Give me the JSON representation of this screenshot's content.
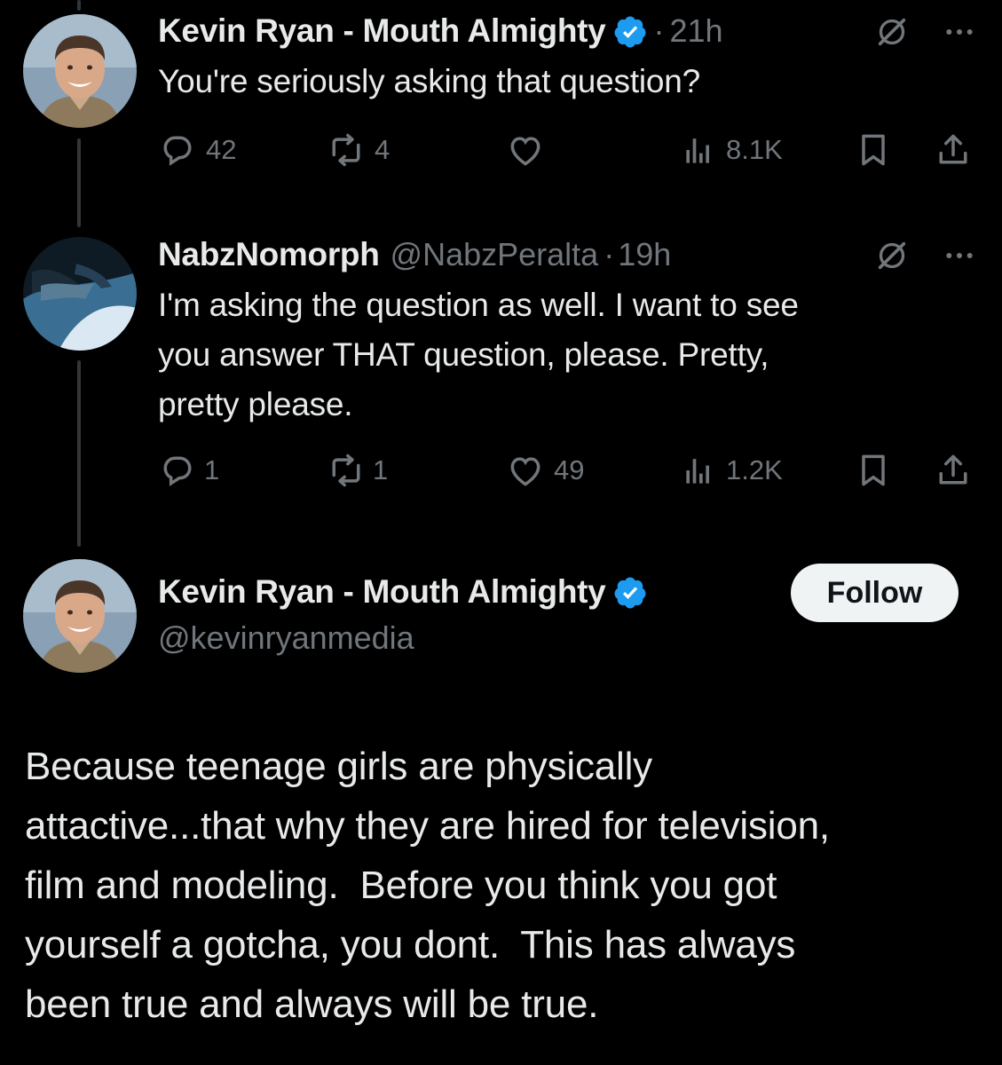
{
  "colors": {
    "background": "#000000",
    "text_primary": "#e7e9ea",
    "text_secondary": "#71767b",
    "verified_blue": "#1d9bf0",
    "follow_bg": "#eff3f4"
  },
  "thread": [
    {
      "display_name": "Kevin Ryan - Mouth Almighty",
      "verified": true,
      "separator": "·",
      "time": "21h",
      "text": "You're seriously asking that question?",
      "metrics": {
        "replies": "42",
        "reposts": "4",
        "likes": "",
        "views": "8.1K"
      },
      "icons": [
        "grok-icon",
        "more-icon",
        "reply-icon",
        "repost-icon",
        "like-icon",
        "views-icon",
        "bookmark-icon",
        "share-icon"
      ]
    },
    {
      "display_name": "NabzNomorph",
      "handle": "@NabzPeralta",
      "separator": "·",
      "time": "19h",
      "text_lines": [
        "I'm asking the question as well. I want to see",
        "you answer THAT question, please. Pretty,",
        "pretty please."
      ],
      "metrics": {
        "replies": "1",
        "reposts": "1",
        "likes": "49",
        "views": "1.2K"
      }
    }
  ],
  "main_post": {
    "display_name": "Kevin Ryan - Mouth Almighty",
    "verified": true,
    "handle": "@kevinryanmedia",
    "follow_label": "Follow",
    "text_lines": [
      "Because teenage girls are physically",
      "attactive...that why they are hired for television,",
      "film and modeling.  Before you think you got",
      "yourself a gotcha, you dont.  This has always",
      "been true and always will be true."
    ]
  }
}
